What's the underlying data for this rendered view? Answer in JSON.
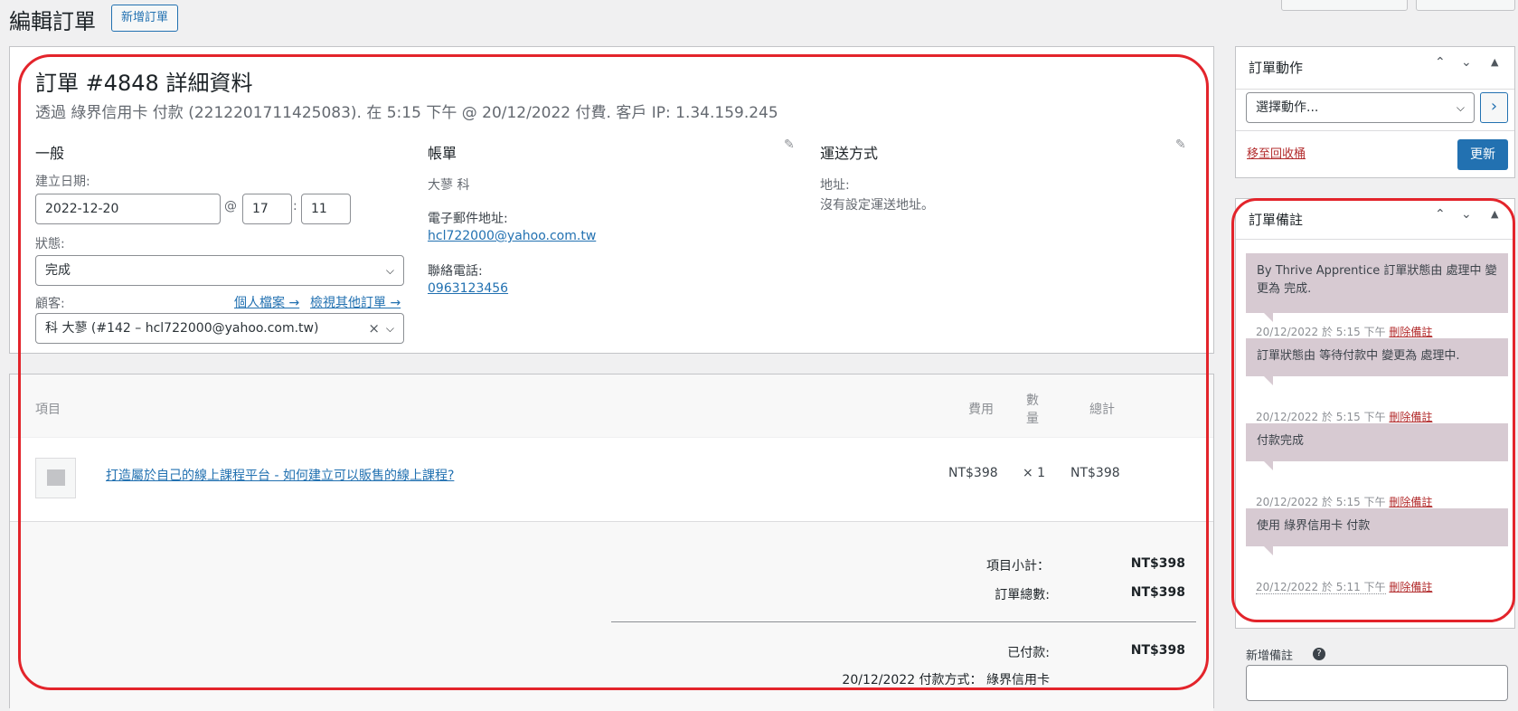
{
  "header": {
    "title": "編輯訂單",
    "new_order_button": "新增訂單"
  },
  "order": {
    "heading": "訂單 #4848 詳細資料",
    "meta": "透過 綠界信用卡 付款 (2212201711425083). 在 5:15 下午 @ 20/12/2022 付費. 客戶 IP: 1.34.159.245",
    "general": {
      "title": "一般",
      "created_label": "建立日期:",
      "date": "2022-12-20",
      "at": "@",
      "hour": "17",
      "colon": ":",
      "minute": "11",
      "status_label": "狀態:",
      "status_value": "完成",
      "customer_label": "顧客:",
      "profile_link": "個人檔案 →",
      "other_orders_link": "檢視其他訂單 →",
      "customer_value": "科 大蓼 (#142 – hcl722000@yahoo.com.tw)",
      "clear": "×"
    },
    "billing": {
      "title": "帳單",
      "name": "大蓼 科",
      "email_label": "電子郵件地址:",
      "email": "hcl722000@yahoo.com.tw",
      "phone_label": "聯絡電話:",
      "phone": "0963123456"
    },
    "shipping": {
      "title": "運送方式",
      "address_label": "地址:",
      "address_value": "沒有設定運送地址。"
    }
  },
  "items": {
    "headers": {
      "item": "項目",
      "cost": "費用",
      "qty_line1": "數",
      "qty_line2": "量",
      "total": "總計"
    },
    "rows": [
      {
        "name": "打造屬於自己的線上課程平台 - 如何建立可以販售的線上課程?",
        "cost": "NT$398",
        "qty": "× 1",
        "total": "NT$398"
      }
    ],
    "totals": {
      "subtotal_label": "項目小計：",
      "subtotal": "NT$398",
      "order_total_label": "訂單總數:",
      "order_total": "NT$398",
      "paid_label": "已付款:",
      "paid": "NT$398",
      "paid_note": "20/12/2022 付款方式： 綠界信用卡"
    }
  },
  "actions": {
    "title": "訂單動作",
    "select": "選擇動作...",
    "go": "›",
    "trash": "移至回收桶",
    "update": "更新"
  },
  "notes": {
    "title": "訂單備註",
    "delete_label": "刪除備註",
    "items": [
      {
        "text": "By Thrive Apprentice 訂單狀態由 處理中 變更為 完成.",
        "date": "20/12/2022 於 5:15 下午"
      },
      {
        "text": "訂單狀態由 等待付款中 變更為 處理中.",
        "date": "20/12/2022 於 5:15 下午"
      },
      {
        "text": "付款完成",
        "date": "20/12/2022 於 5:15 下午"
      },
      {
        "text": "使用 綠界信用卡 付款",
        "date": "20/12/2022 於 5:11 下午"
      }
    ],
    "add_note_label": "新增備註",
    "help": "?"
  },
  "colors": {
    "accent": "#2271b1",
    "note_bg": "#d7cad2",
    "annotation": "#e3242b",
    "danger": "#b32d2e"
  },
  "icons": [
    "chevron-up-icon",
    "chevron-down-icon",
    "triangle-up-icon",
    "pencil-icon",
    "image-placeholder-icon",
    "help-icon"
  ]
}
